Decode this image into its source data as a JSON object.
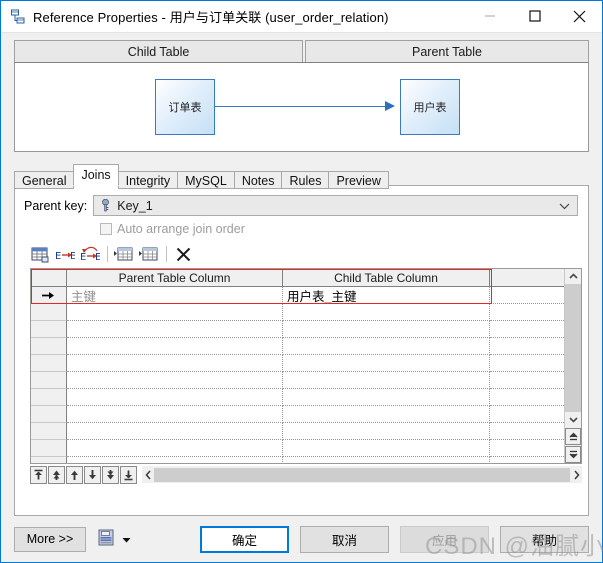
{
  "window": {
    "title": "Reference Properties - 用户与订单关联 (user_order_relation)",
    "icon": "reference-icon",
    "controls": {
      "minimize": "minimize-icon",
      "maximize": "maximize-icon",
      "close": "close-icon"
    }
  },
  "diagram": {
    "child_header": "Child Table",
    "parent_header": "Parent Table",
    "child_table": "订单表",
    "parent_table": "用户表",
    "relation_arrow": "arrow-right-icon",
    "box_border_color": "#3a7bbf",
    "box_fill_color": "#c5e0f5"
  },
  "tabs": [
    {
      "label": "General",
      "active": false
    },
    {
      "label": "Joins",
      "active": true
    },
    {
      "label": "Integrity",
      "active": false
    },
    {
      "label": "MySQL",
      "active": false
    },
    {
      "label": "Notes",
      "active": false
    },
    {
      "label": "Rules",
      "active": false
    },
    {
      "label": "Preview",
      "active": false
    }
  ],
  "joins": {
    "parent_key_label": "Parent key:",
    "parent_key_value": "Key_1",
    "parent_key_icon": "key-icon",
    "parent_key_dropdown_icon": "chevron-down-icon",
    "auto_arrange_label": "Auto arrange join order",
    "auto_arrange_checked": false,
    "toolbar": [
      {
        "name": "select-all-columns-icon"
      },
      {
        "name": "join-inner-icon"
      },
      {
        "name": "join-outer-icon"
      },
      {
        "name": "insert-column-before-icon"
      },
      {
        "name": "insert-column-after-icon"
      },
      {
        "name": "delete-row-icon"
      }
    ],
    "grid": {
      "headers": [
        "",
        "Parent Table Column",
        "Child Table Column",
        ""
      ],
      "rows": [
        {
          "marker": "arrow-right-icon",
          "parent_column": "主键",
          "child_column": "用户表_主键",
          "extra": ""
        },
        {
          "marker": "",
          "parent_column": "",
          "child_column": "",
          "extra": ""
        },
        {
          "marker": "",
          "parent_column": "",
          "child_column": "",
          "extra": ""
        },
        {
          "marker": "",
          "parent_column": "",
          "child_column": "",
          "extra": ""
        },
        {
          "marker": "",
          "parent_column": "",
          "child_column": "",
          "extra": ""
        },
        {
          "marker": "",
          "parent_column": "",
          "child_column": "",
          "extra": ""
        },
        {
          "marker": "",
          "parent_column": "",
          "child_column": "",
          "extra": ""
        },
        {
          "marker": "",
          "parent_column": "",
          "child_column": "",
          "extra": ""
        },
        {
          "marker": "",
          "parent_column": "",
          "child_column": "",
          "extra": ""
        },
        {
          "marker": "",
          "parent_column": "",
          "child_column": "",
          "extra": ""
        },
        {
          "marker": "",
          "parent_column": "",
          "child_column": "",
          "extra": ""
        }
      ],
      "selection_color": "#e02b20"
    },
    "row_nav_buttons": [
      "move-first-icon",
      "move-up-fast-icon",
      "move-up-icon",
      "move-down-icon",
      "move-down-fast-icon",
      "move-last-icon"
    ]
  },
  "footer": {
    "more_label": "More >>",
    "save_icon": "save-preset-icon",
    "save_caret_icon": "caret-down-icon",
    "ok_label": "确定",
    "cancel_label": "取消",
    "apply_label": "应用",
    "help_label": "帮助",
    "apply_disabled": true,
    "accent_color": "#0078d7"
  },
  "watermark": "CSDN @油腻小男"
}
